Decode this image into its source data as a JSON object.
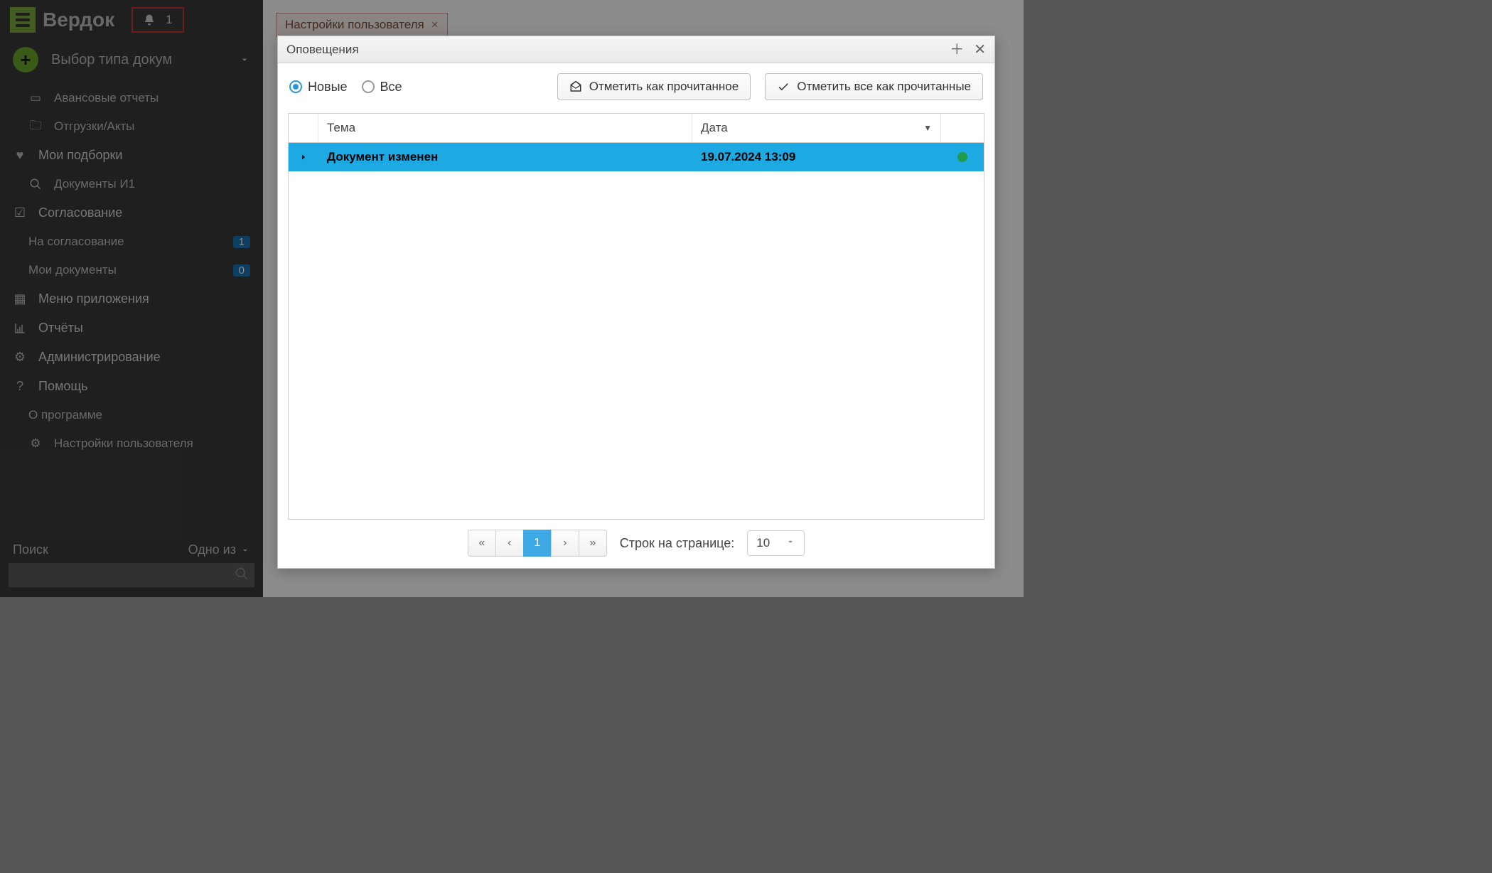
{
  "brand": "Вердок",
  "bell_count": "1",
  "sidebar": {
    "doc_type_label": "Выбор типа докум",
    "items": [
      {
        "label": "Авансовые отчеты"
      },
      {
        "label": "Отгрузки/Акты"
      }
    ],
    "section_fav": "Мои подборки",
    "fav_sub": "Документы И1",
    "section_approve": "Согласование",
    "approve_items": [
      {
        "label": "На согласование",
        "badge": "1"
      },
      {
        "label": "Мои документы",
        "badge": "0"
      }
    ],
    "menu_app": "Меню приложения",
    "reports": "Отчёты",
    "admin": "Администрирование",
    "help": "Помощь",
    "about": "О программе",
    "settings": "Настройки пользователя",
    "search_label": "Поиск",
    "search_mode": "Одно из"
  },
  "tab": {
    "label": "Настройки пользователя"
  },
  "modal": {
    "title": "Оповещения",
    "radio_new": "Новые",
    "radio_all": "Все",
    "btn_mark_read": "Отметить как прочитанное",
    "btn_mark_all": "Отметить все как прочитанные",
    "col_topic": "Тема",
    "col_date": "Дата",
    "rows": [
      {
        "topic": "Документ изменен",
        "date": "19.07.2024 13:09"
      }
    ],
    "pager": {
      "page": "1",
      "rows_label": "Строк на странице:",
      "rows_value": "10"
    }
  }
}
